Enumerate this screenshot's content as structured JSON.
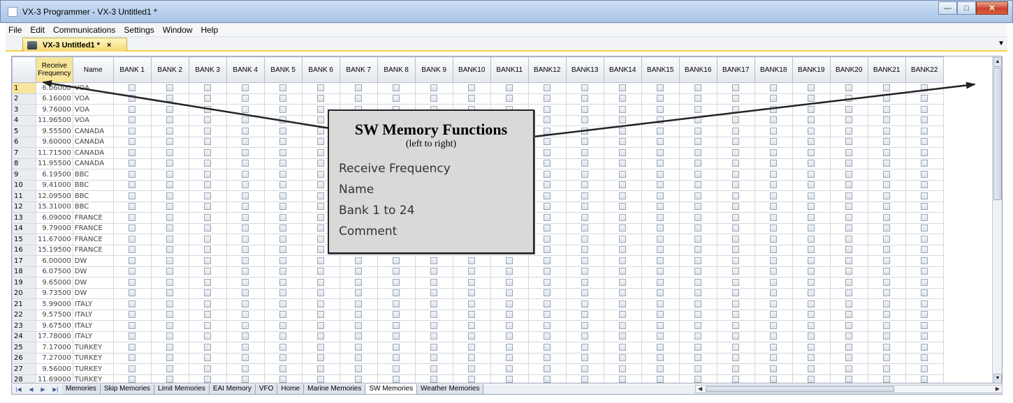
{
  "window": {
    "title": "VX-3 Programmer - VX-3 Untitled1 *"
  },
  "menu": [
    "File",
    "Edit",
    "Communications",
    "Settings",
    "Window",
    "Help"
  ],
  "doc_tab": {
    "label": "VX-3 Untitled1 *",
    "close": "×"
  },
  "grid": {
    "headers": {
      "receive_frequency": "Receive Frequency",
      "name": "Name",
      "banks": [
        "BANK 1",
        "BANK 2",
        "BANK 3",
        "BANK 4",
        "BANK 5",
        "BANK 6",
        "BANK 7",
        "BANK 8",
        "BANK 9",
        "BANK10",
        "BANK11",
        "BANK12",
        "BANK13",
        "BANK14",
        "BANK15",
        "BANK16",
        "BANK17",
        "BANK18",
        "BANK19",
        "BANK20",
        "BANK21",
        "BANK22"
      ]
    },
    "rows": [
      {
        "num": "1",
        "freq": "6.06000",
        "name": "VOA"
      },
      {
        "num": "2",
        "freq": "6.16000",
        "name": "VOA"
      },
      {
        "num": "3",
        "freq": "9.76000",
        "name": "VOA"
      },
      {
        "num": "4",
        "freq": "11.96500",
        "name": "VOA"
      },
      {
        "num": "5",
        "freq": "9.55500",
        "name": "CANADA"
      },
      {
        "num": "6",
        "freq": "9.60000",
        "name": "CANADA"
      },
      {
        "num": "7",
        "freq": "11.71500",
        "name": "CANADA"
      },
      {
        "num": "8",
        "freq": "11.95500",
        "name": "CANADA"
      },
      {
        "num": "9",
        "freq": "6.19500",
        "name": "BBC"
      },
      {
        "num": "10",
        "freq": "9.41000",
        "name": "BBC"
      },
      {
        "num": "11",
        "freq": "12.09500",
        "name": "BBC"
      },
      {
        "num": "12",
        "freq": "15.31000",
        "name": "BBC"
      },
      {
        "num": "13",
        "freq": "6.09000",
        "name": "FRANCE"
      },
      {
        "num": "14",
        "freq": "9.79000",
        "name": "FRANCE"
      },
      {
        "num": "15",
        "freq": "11.67000",
        "name": "FRANCE"
      },
      {
        "num": "16",
        "freq": "15.19500",
        "name": "FRANCE"
      },
      {
        "num": "17",
        "freq": "6.00000",
        "name": "DW"
      },
      {
        "num": "18",
        "freq": "6.07500",
        "name": "DW"
      },
      {
        "num": "19",
        "freq": "9.65000",
        "name": "DW"
      },
      {
        "num": "20",
        "freq": "9.73500",
        "name": "DW"
      },
      {
        "num": "21",
        "freq": "5.99000",
        "name": "ITALY"
      },
      {
        "num": "22",
        "freq": "9.57500",
        "name": "ITALY"
      },
      {
        "num": "23",
        "freq": "9.67500",
        "name": "ITALY"
      },
      {
        "num": "24",
        "freq": "17.78000",
        "name": "ITALY"
      },
      {
        "num": "25",
        "freq": "7.17000",
        "name": "TURKEY"
      },
      {
        "num": "26",
        "freq": "7.27000",
        "name": "TURKEY"
      },
      {
        "num": "27",
        "freq": "9.56000",
        "name": "TURKEY"
      },
      {
        "num": "28",
        "freq": "11.69000",
        "name": "TURKEY"
      }
    ]
  },
  "sheet_tabs": [
    "Memories",
    "Skip Memories",
    "Limit Memories",
    "EAI Memory",
    "VFO",
    "Home",
    "Marine Memories",
    "SW Memories",
    "Weather Memories"
  ],
  "active_sheet": "SW Memories",
  "callout": {
    "title": "SW Memory Functions",
    "subtitle": "(left to right)",
    "items": [
      "Receive Frequency",
      "Name",
      "Bank 1 to 24",
      "Comment"
    ]
  }
}
